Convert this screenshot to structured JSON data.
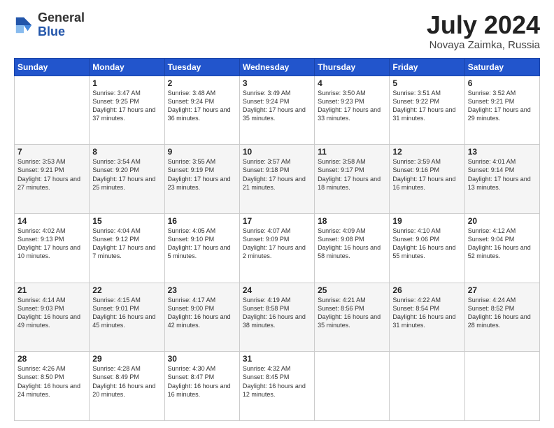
{
  "header": {
    "logo_general": "General",
    "logo_blue": "Blue",
    "month_title": "July 2024",
    "location": "Novaya Zaimka, Russia"
  },
  "weekdays": [
    "Sunday",
    "Monday",
    "Tuesday",
    "Wednesday",
    "Thursday",
    "Friday",
    "Saturday"
  ],
  "weeks": [
    [
      {
        "day": "",
        "sunrise": "",
        "sunset": "",
        "daylight": ""
      },
      {
        "day": "1",
        "sunrise": "3:47 AM",
        "sunset": "9:25 PM",
        "daylight": "17 hours and 37 minutes."
      },
      {
        "day": "2",
        "sunrise": "3:48 AM",
        "sunset": "9:24 PM",
        "daylight": "17 hours and 36 minutes."
      },
      {
        "day": "3",
        "sunrise": "3:49 AM",
        "sunset": "9:24 PM",
        "daylight": "17 hours and 35 minutes."
      },
      {
        "day": "4",
        "sunrise": "3:50 AM",
        "sunset": "9:23 PM",
        "daylight": "17 hours and 33 minutes."
      },
      {
        "day": "5",
        "sunrise": "3:51 AM",
        "sunset": "9:22 PM",
        "daylight": "17 hours and 31 minutes."
      },
      {
        "day": "6",
        "sunrise": "3:52 AM",
        "sunset": "9:21 PM",
        "daylight": "17 hours and 29 minutes."
      }
    ],
    [
      {
        "day": "7",
        "sunrise": "3:53 AM",
        "sunset": "9:21 PM",
        "daylight": "17 hours and 27 minutes."
      },
      {
        "day": "8",
        "sunrise": "3:54 AM",
        "sunset": "9:20 PM",
        "daylight": "17 hours and 25 minutes."
      },
      {
        "day": "9",
        "sunrise": "3:55 AM",
        "sunset": "9:19 PM",
        "daylight": "17 hours and 23 minutes."
      },
      {
        "day": "10",
        "sunrise": "3:57 AM",
        "sunset": "9:18 PM",
        "daylight": "17 hours and 21 minutes."
      },
      {
        "day": "11",
        "sunrise": "3:58 AM",
        "sunset": "9:17 PM",
        "daylight": "17 hours and 18 minutes."
      },
      {
        "day": "12",
        "sunrise": "3:59 AM",
        "sunset": "9:16 PM",
        "daylight": "17 hours and 16 minutes."
      },
      {
        "day": "13",
        "sunrise": "4:01 AM",
        "sunset": "9:14 PM",
        "daylight": "17 hours and 13 minutes."
      }
    ],
    [
      {
        "day": "14",
        "sunrise": "4:02 AM",
        "sunset": "9:13 PM",
        "daylight": "17 hours and 10 minutes."
      },
      {
        "day": "15",
        "sunrise": "4:04 AM",
        "sunset": "9:12 PM",
        "daylight": "17 hours and 7 minutes."
      },
      {
        "day": "16",
        "sunrise": "4:05 AM",
        "sunset": "9:10 PM",
        "daylight": "17 hours and 5 minutes."
      },
      {
        "day": "17",
        "sunrise": "4:07 AM",
        "sunset": "9:09 PM",
        "daylight": "17 hours and 2 minutes."
      },
      {
        "day": "18",
        "sunrise": "4:09 AM",
        "sunset": "9:08 PM",
        "daylight": "16 hours and 58 minutes."
      },
      {
        "day": "19",
        "sunrise": "4:10 AM",
        "sunset": "9:06 PM",
        "daylight": "16 hours and 55 minutes."
      },
      {
        "day": "20",
        "sunrise": "4:12 AM",
        "sunset": "9:04 PM",
        "daylight": "16 hours and 52 minutes."
      }
    ],
    [
      {
        "day": "21",
        "sunrise": "4:14 AM",
        "sunset": "9:03 PM",
        "daylight": "16 hours and 49 minutes."
      },
      {
        "day": "22",
        "sunrise": "4:15 AM",
        "sunset": "9:01 PM",
        "daylight": "16 hours and 45 minutes."
      },
      {
        "day": "23",
        "sunrise": "4:17 AM",
        "sunset": "9:00 PM",
        "daylight": "16 hours and 42 minutes."
      },
      {
        "day": "24",
        "sunrise": "4:19 AM",
        "sunset": "8:58 PM",
        "daylight": "16 hours and 38 minutes."
      },
      {
        "day": "25",
        "sunrise": "4:21 AM",
        "sunset": "8:56 PM",
        "daylight": "16 hours and 35 minutes."
      },
      {
        "day": "26",
        "sunrise": "4:22 AM",
        "sunset": "8:54 PM",
        "daylight": "16 hours and 31 minutes."
      },
      {
        "day": "27",
        "sunrise": "4:24 AM",
        "sunset": "8:52 PM",
        "daylight": "16 hours and 28 minutes."
      }
    ],
    [
      {
        "day": "28",
        "sunrise": "4:26 AM",
        "sunset": "8:50 PM",
        "daylight": "16 hours and 24 minutes."
      },
      {
        "day": "29",
        "sunrise": "4:28 AM",
        "sunset": "8:49 PM",
        "daylight": "16 hours and 20 minutes."
      },
      {
        "day": "30",
        "sunrise": "4:30 AM",
        "sunset": "8:47 PM",
        "daylight": "16 hours and 16 minutes."
      },
      {
        "day": "31",
        "sunrise": "4:32 AM",
        "sunset": "8:45 PM",
        "daylight": "16 hours and 12 minutes."
      },
      {
        "day": "",
        "sunrise": "",
        "sunset": "",
        "daylight": ""
      },
      {
        "day": "",
        "sunrise": "",
        "sunset": "",
        "daylight": ""
      },
      {
        "day": "",
        "sunrise": "",
        "sunset": "",
        "daylight": ""
      }
    ]
  ]
}
